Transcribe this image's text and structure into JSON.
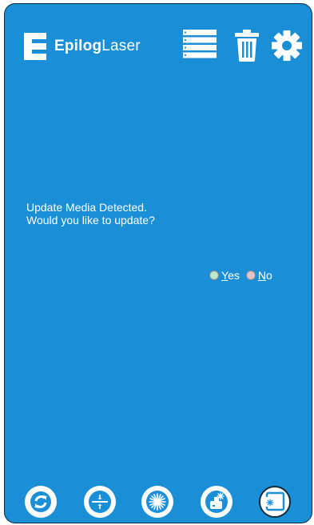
{
  "header": {
    "logo_bold": "Epilog",
    "logo_light": "Laser",
    "icons": [
      "job-list-icon",
      "trash-icon",
      "gear-icon"
    ]
  },
  "dialog": {
    "line1": "Update Media Detected.",
    "line2": "Would you like to update?",
    "yes_first": "Y",
    "yes_rest": "es",
    "no_first": "N",
    "no_rest": "o"
  },
  "toolbar": {
    "icons": [
      "refresh-icon",
      "focus-icon",
      "laser-fire-icon",
      "laser-job-icon",
      "frame-icon"
    ]
  },
  "colors": {
    "background": "#1a8fd8",
    "yes_radio": "#bfe8c4",
    "no_radio": "#e4c0c8"
  }
}
